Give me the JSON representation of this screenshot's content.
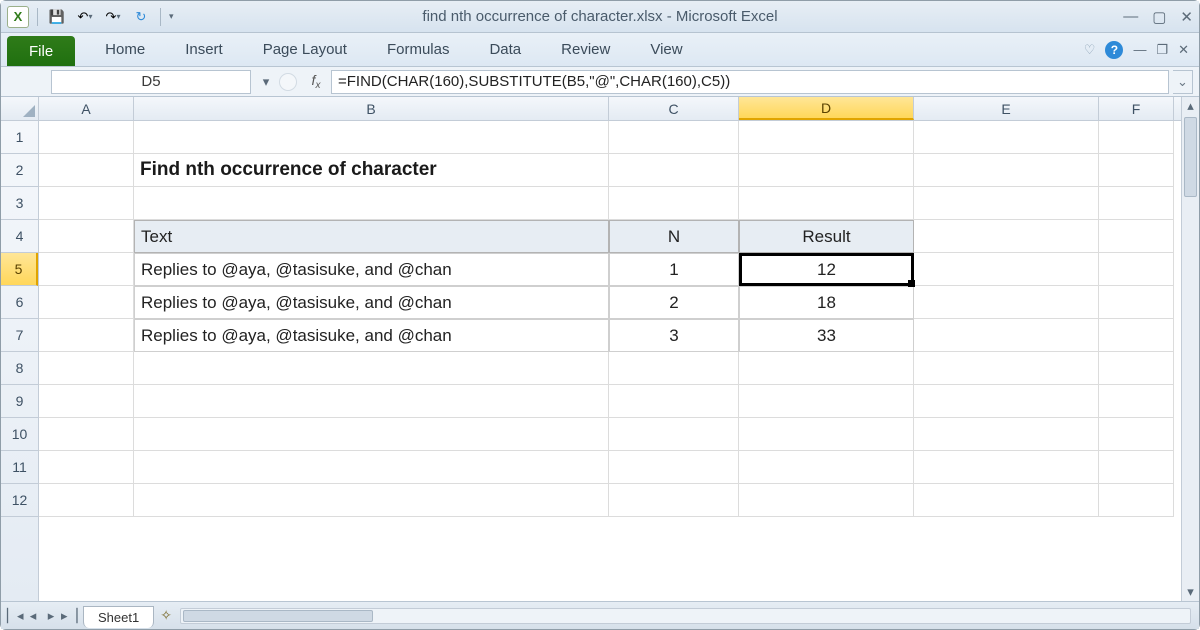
{
  "window": {
    "title": "find nth occurrence of character.xlsx  -  Microsoft Excel"
  },
  "qat": {
    "excel_icon": "X",
    "save": "💾",
    "undo": "↶",
    "redo": "↷",
    "sync": "↻"
  },
  "ribbon": {
    "file": "File",
    "tabs": [
      "Home",
      "Insert",
      "Page Layout",
      "Formulas",
      "Data",
      "Review",
      "View"
    ],
    "minimize": "♡",
    "help": "?"
  },
  "formula_bar": {
    "name_box": "D5",
    "formula": "=FIND(CHAR(160),SUBSTITUTE(B5,\"@\",CHAR(160),C5))"
  },
  "columns": [
    "A",
    "B",
    "C",
    "D",
    "E",
    "F"
  ],
  "rows": [
    "1",
    "2",
    "3",
    "4",
    "5",
    "6",
    "7",
    "8",
    "9",
    "10",
    "11",
    "12"
  ],
  "active": {
    "col": "D",
    "row": "5"
  },
  "sheet": {
    "title": "Find nth occurrence of character",
    "headers": {
      "text": "Text",
      "n": "N",
      "result": "Result"
    },
    "data": [
      {
        "text": "Replies to @aya, @tasisuke, and @chan",
        "n": "1",
        "result": "12"
      },
      {
        "text": "Replies to @aya, @tasisuke, and @chan",
        "n": "2",
        "result": "18"
      },
      {
        "text": "Replies to @aya, @tasisuke, and @chan",
        "n": "3",
        "result": "33"
      }
    ]
  },
  "sheetbar": {
    "tab_name": "Sheet1"
  }
}
